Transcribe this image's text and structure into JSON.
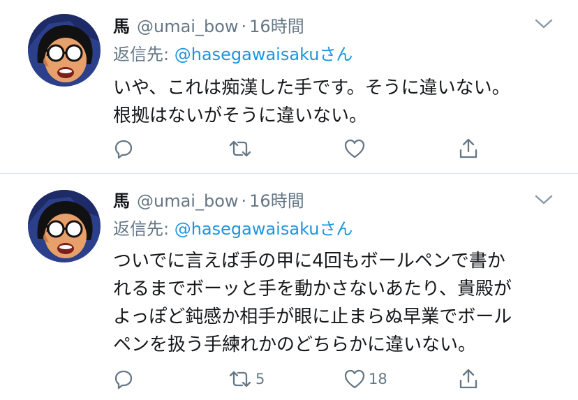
{
  "tweets": [
    {
      "display_name": "馬",
      "handle": "@umai_bow",
      "separator": "·",
      "time": "16時間",
      "reply_prefix": "返信先: ",
      "reply_mention": "@hasegawaisaku",
      "reply_suffix": "さん",
      "body_lines": [
        "いや、これは痴漢した手です。そうに違いない。",
        "根拠はないがそうに違いない。"
      ],
      "retweet_count": "",
      "like_count": ""
    },
    {
      "display_name": "馬",
      "handle": "@umai_bow",
      "separator": "·",
      "time": "16時間",
      "reply_prefix": "返信先: ",
      "reply_mention": "@hasegawaisaku",
      "reply_suffix": "さん",
      "body_lines": [
        "ついでに言えば手の甲に4回もボールペンで書か",
        "れるまでボーッと手を動かさないあたり、貴殿が",
        "よっぽど鈍感か相手が眼に止まらぬ早業でボール",
        "ペンを扱う手練れかのどちらかに違いない。"
      ],
      "retweet_count": "5",
      "like_count": "18"
    }
  ],
  "icons": {
    "avatar": "manga-character-avatar",
    "caret": "chevron-down-icon",
    "reply": "reply-icon",
    "retweet": "retweet-icon",
    "like": "heart-icon",
    "share": "share-icon"
  },
  "colors": {
    "text": "#14171a",
    "secondary": "#657786",
    "link": "#1b95e0",
    "divider": "#e1e8ed"
  }
}
